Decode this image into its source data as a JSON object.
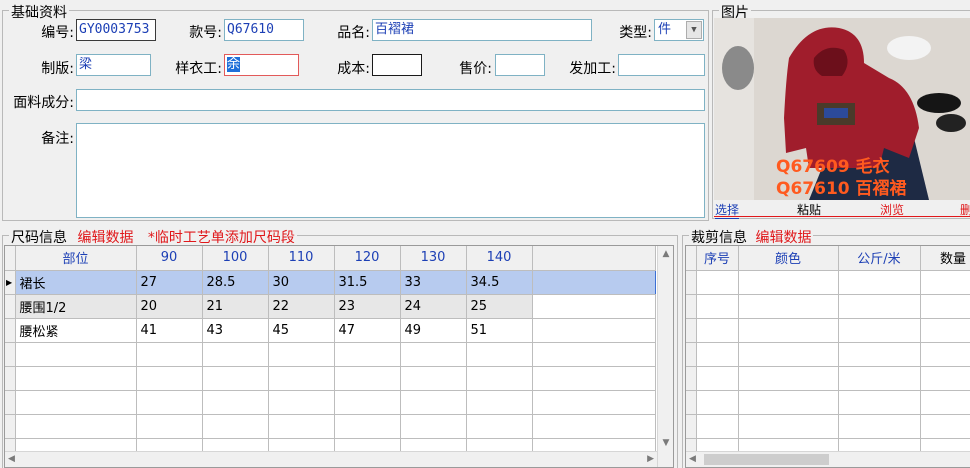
{
  "basic": {
    "title": "基础资料",
    "labels": {
      "code": "编号:",
      "style_no": "款号:",
      "product_name": "品名:",
      "type": "类型:",
      "pattern": "制版:",
      "sample_maker": "样衣工:",
      "cost": "成本:",
      "price": "售价:",
      "processor": "发加工:",
      "fabric": "面料成分:",
      "remark": "备注:"
    },
    "values": {
      "code": "GY0003753",
      "style_no": "Q67610",
      "product_name": "百褶裙",
      "type": "件",
      "pattern": "梁",
      "sample_maker": "余",
      "cost": "",
      "price": "",
      "processor": "",
      "fabric": "",
      "remark": ""
    }
  },
  "picture": {
    "title": "图片",
    "caption_line1": "Q67609 毛衣",
    "caption_line2": "Q67610 百褶裙",
    "buttons": {
      "select": "选择",
      "paste": "粘贴",
      "browse": "浏览",
      "delete": "删"
    }
  },
  "size_info": {
    "title": "尺码信息",
    "edit": "编辑数据",
    "note": "*临时工艺单添加尺码段",
    "columns": [
      "部位",
      "90",
      "100",
      "110",
      "120",
      "130",
      "140"
    ],
    "rows": [
      {
        "part": "裙长",
        "values": [
          "27",
          "28.5",
          "30",
          "31.5",
          "33",
          "34.5"
        ]
      },
      {
        "part": "腰围1/2",
        "values": [
          "20",
          "21",
          "22",
          "23",
          "24",
          "25"
        ]
      },
      {
        "part": "腰松紧",
        "values": [
          "41",
          "43",
          "45",
          "47",
          "49",
          "51"
        ]
      }
    ]
  },
  "cut_info": {
    "title": "裁剪信息",
    "edit": "编辑数据",
    "columns": [
      "序号",
      "颜色",
      "公斤/米",
      "数量"
    ]
  }
}
